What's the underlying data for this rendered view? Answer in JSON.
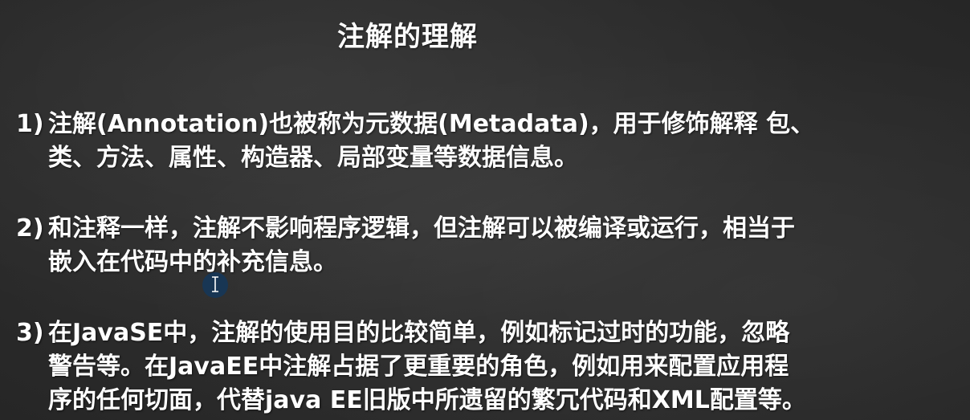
{
  "slide": {
    "title": "注解的理解",
    "items": [
      {
        "number": "1)",
        "lines": [
          "注解(Annotation)也被称为元数据(Metadata)，用于修饰解释 包、",
          "类、方法、属性、构造器、局部变量等数据信息。"
        ]
      },
      {
        "number": "2)",
        "lines": [
          "和注释一样，注解不影响程序逻辑，但注解可以被编译或运行，相当于",
          "嵌入在代码中的补充信息。"
        ]
      },
      {
        "number": "3)",
        "lines": [
          "在JavaSE中，注解的使用目的比较简单，例如标记过时的功能，忽略",
          "警告等。在JavaEE中注解占据了更重要的角色，例如用来配置应用程",
          "序的任何切面，代替java EE旧版中所遗留的繁冗代码和XML配置等。"
        ]
      }
    ]
  },
  "colors": {
    "background": "#2e2e2e",
    "text": "#ffffff",
    "cursor_highlight": "#14375a"
  },
  "icons": {
    "cursor": "text-cursor-icon"
  }
}
